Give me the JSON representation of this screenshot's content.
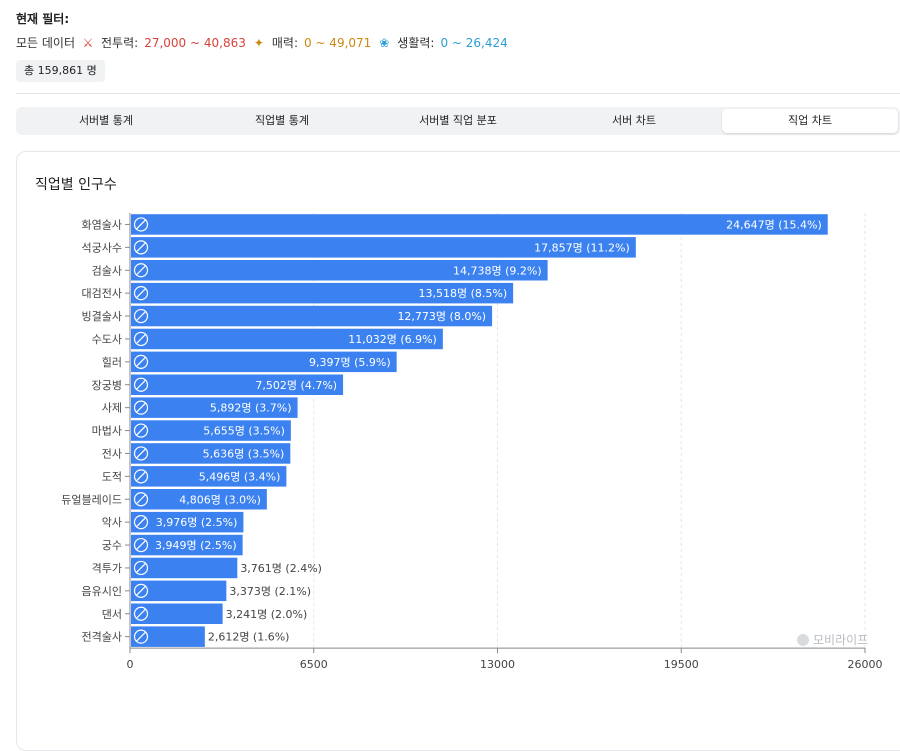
{
  "filters": {
    "title": "현재 필터:",
    "all_data_label": "모든 데이터",
    "combat_label": "전투력:",
    "combat_range": "27,000 ~ 40,863",
    "charm_label": "매력:",
    "charm_range": "0 ~ 49,071",
    "life_label": "생활력:",
    "life_range": "0 ~ 26,424",
    "total": "총 159,861 명"
  },
  "colors": {
    "bar": "#3b82f0",
    "combat": "#d9423a",
    "charm": "#c98a14",
    "life": "#2b9ed6"
  },
  "tabs": [
    {
      "label": "서버별 통계",
      "active": false
    },
    {
      "label": "직업별 통계",
      "active": false
    },
    {
      "label": "서버별 직업 분포",
      "active": false
    },
    {
      "label": "서버 차트",
      "active": false
    },
    {
      "label": "직업 차트",
      "active": true
    }
  ],
  "card_title": "직업별 인구수",
  "watermark": "모비라이프",
  "chart_data": {
    "type": "bar",
    "orientation": "horizontal",
    "title": "직업별 인구수",
    "categories": [
      "화염술사",
      "석궁사수",
      "검술사",
      "대검전사",
      "빙결술사",
      "수도사",
      "힐러",
      "장궁병",
      "사제",
      "마법사",
      "전사",
      "도적",
      "듀얼블레이드",
      "악사",
      "궁수",
      "격투가",
      "음유시인",
      "댄서",
      "전격술사"
    ],
    "values": [
      24647,
      17857,
      14738,
      13518,
      12773,
      11032,
      9397,
      7502,
      5892,
      5655,
      5636,
      5496,
      4806,
      3976,
      3949,
      3761,
      3373,
      3241,
      2612
    ],
    "labels": [
      "24,647명 (15.4%)",
      "17,857명 (11.2%)",
      "14,738명 (9.2%)",
      "13,518명 (8.5%)",
      "12,773명 (8.0%)",
      "11,032명 (6.9%)",
      "9,397명 (5.9%)",
      "7,502명 (4.7%)",
      "5,892명 (3.7%)",
      "5,655명 (3.5%)",
      "5,636명 (3.5%)",
      "5,496명 (3.4%)",
      "4,806명 (3.0%)",
      "3,976명 (2.5%)",
      "3,949명 (2.5%)",
      "3,761명 (2.4%)",
      "3,373명 (2.1%)",
      "3,241명 (2.0%)",
      "2,612명 (1.6%)"
    ],
    "xlim": [
      0,
      26000
    ],
    "xticks": [
      0,
      6500,
      13000,
      19500,
      26000
    ],
    "grid": true
  }
}
